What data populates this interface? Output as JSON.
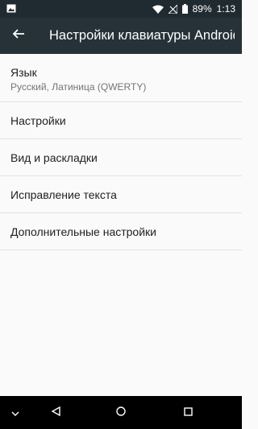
{
  "status_bar": {
    "battery_percent": "89%",
    "time": "1:13"
  },
  "app_bar": {
    "title": "Настройки клавиатуры Android",
    "back_icon": "arrow-back-icon"
  },
  "menu": {
    "items": [
      {
        "label": "Язык",
        "sub": "Русский, Латиница (QWERTY)"
      },
      {
        "label": "Настройки"
      },
      {
        "label": "Вид и раскладки"
      },
      {
        "label": "Исправление текста"
      },
      {
        "label": "Дополнительные настройки"
      }
    ]
  },
  "nav_bar": {
    "icons": [
      "chevron-down-icon",
      "back-triangle-icon",
      "home-circle-icon",
      "recents-square-icon"
    ]
  },
  "colors": {
    "status_bar": "#1f2b30",
    "app_bar": "#263238",
    "background": "#fafafa",
    "nav_bar": "#000000"
  }
}
